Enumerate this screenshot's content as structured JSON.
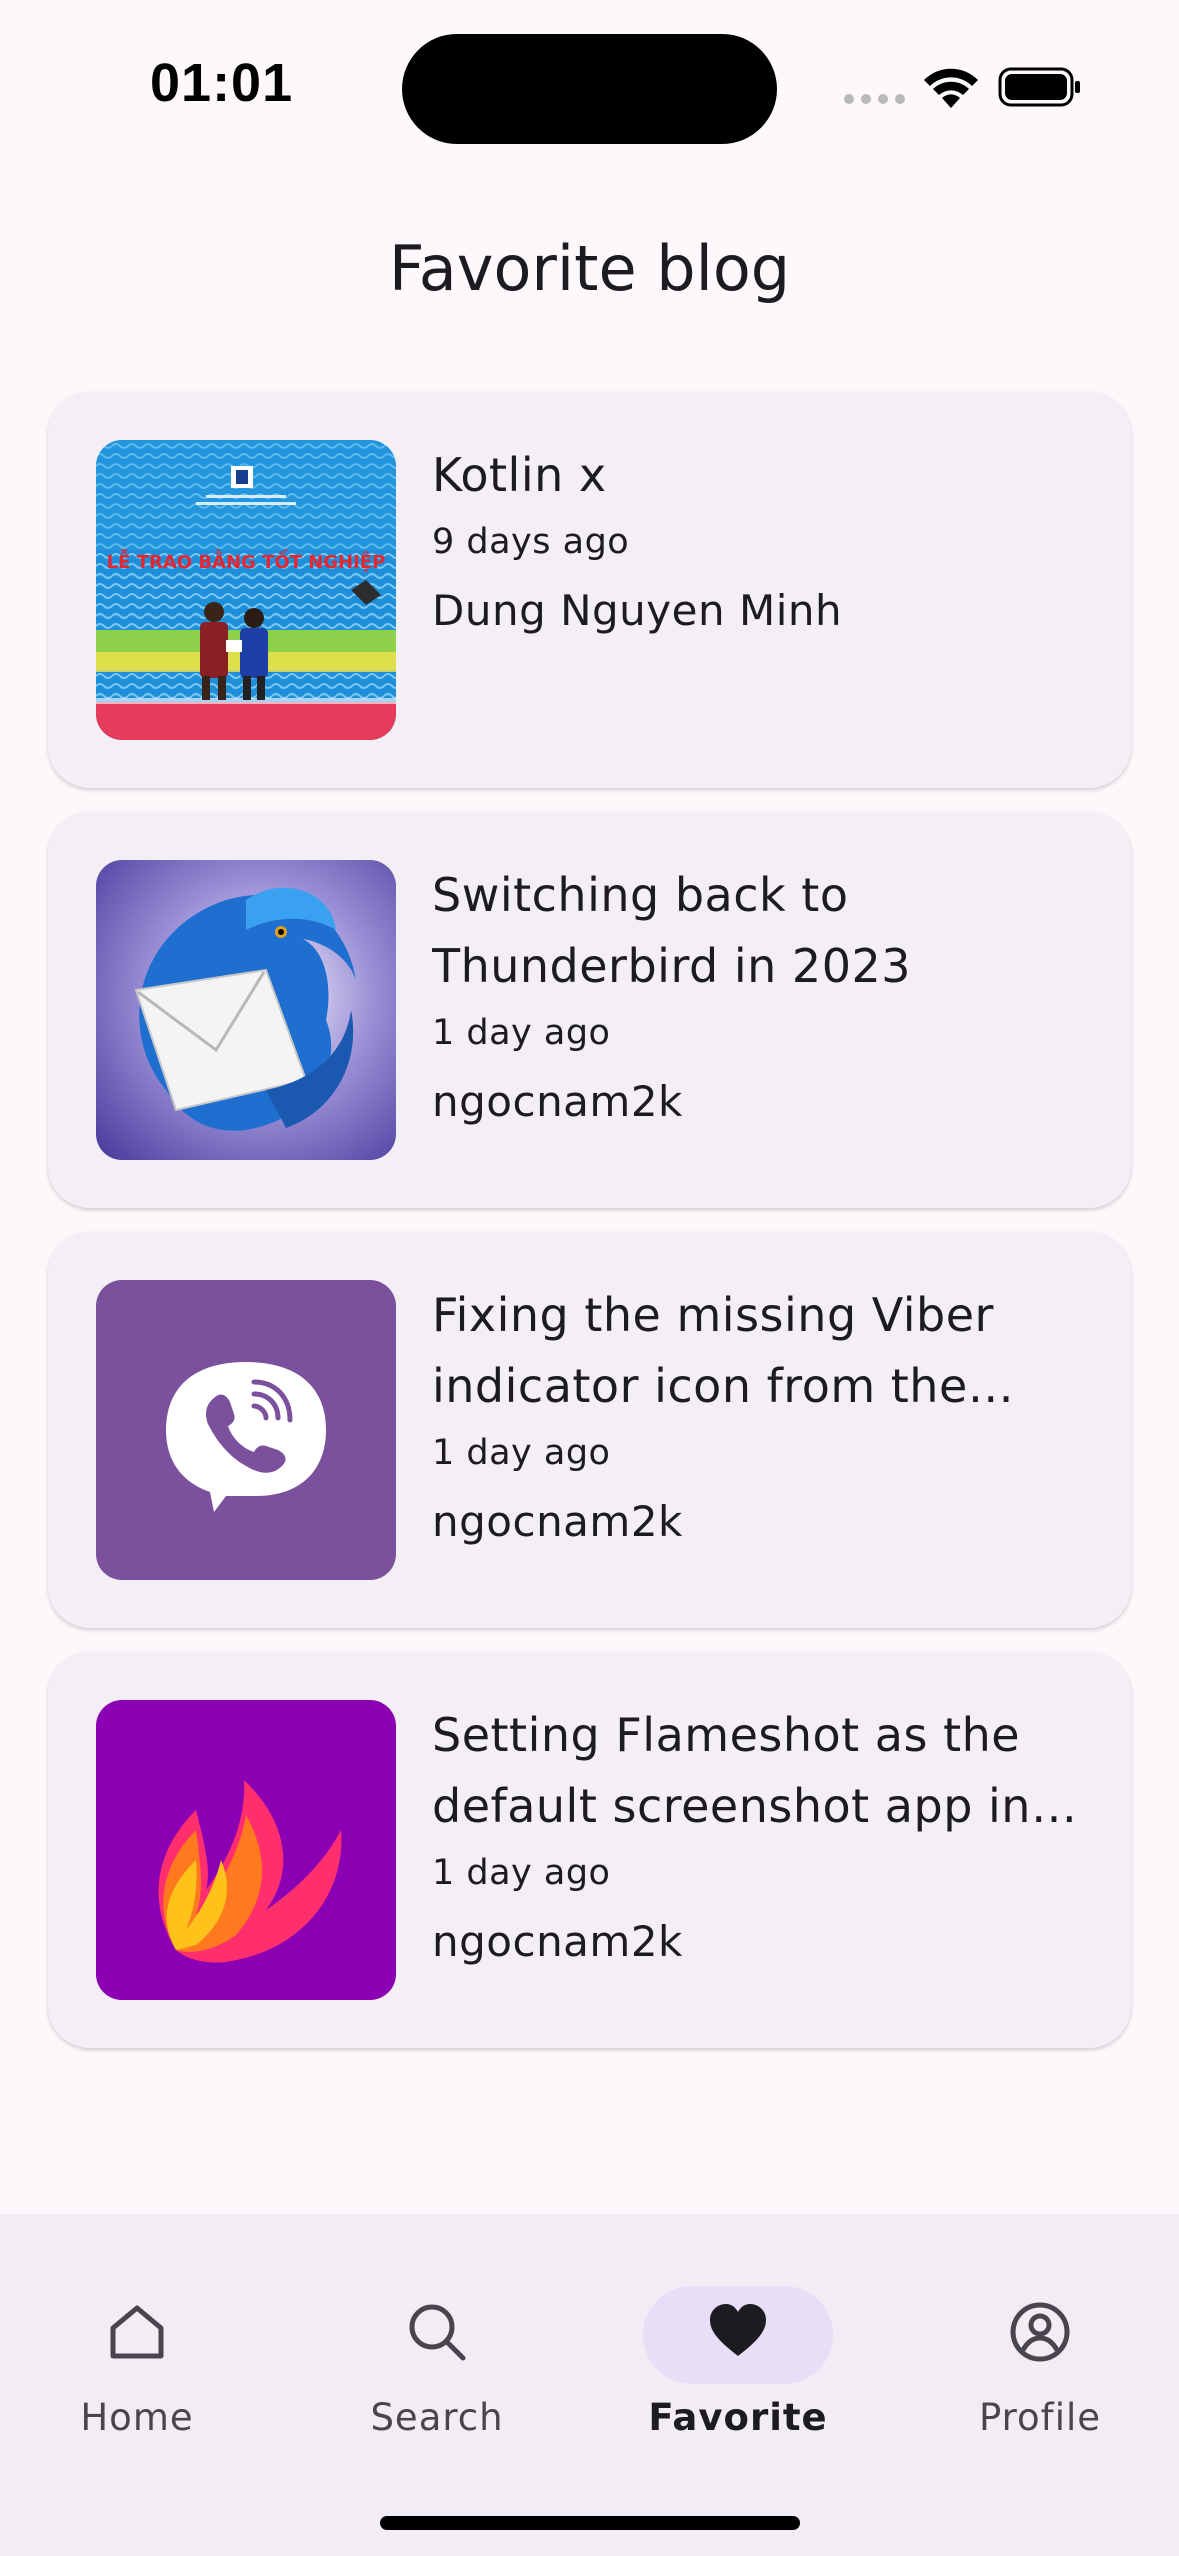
{
  "status_bar": {
    "time": "01:01"
  },
  "page": {
    "title": "Favorite blog"
  },
  "posts": [
    {
      "title": "Kotlin x",
      "date": "9 days ago",
      "author": "Dung Nguyen Minh",
      "banner_text": "LỄ TRAO BẰNG TỐT NGHIỆP"
    },
    {
      "title": "Switching back to Thunderbird in 2023",
      "date": "1 day ago",
      "author": "ngocnam2k"
    },
    {
      "title": "Fixing the missing Viber indicator icon from the Cinnamon panel",
      "date": "1 day ago",
      "author": "ngocnam2k"
    },
    {
      "title": "Setting Flameshot as the default screenshot app in Ubuntu",
      "date": "1 day ago",
      "author": "ngocnam2k"
    }
  ],
  "nav": {
    "items": [
      {
        "label": "Home",
        "icon": "home-icon"
      },
      {
        "label": "Search",
        "icon": "search-icon"
      },
      {
        "label": "Favorite",
        "icon": "heart-icon",
        "active": true
      },
      {
        "label": "Profile",
        "icon": "profile-icon"
      }
    ]
  },
  "colors": {
    "background": "#fdf8fc",
    "card": "#f4eff4",
    "nav_background": "#f2ecf5",
    "nav_active_pill": "#e8def8",
    "viber_purple": "#7b519d",
    "flameshot_purple": "#8b00b2"
  }
}
